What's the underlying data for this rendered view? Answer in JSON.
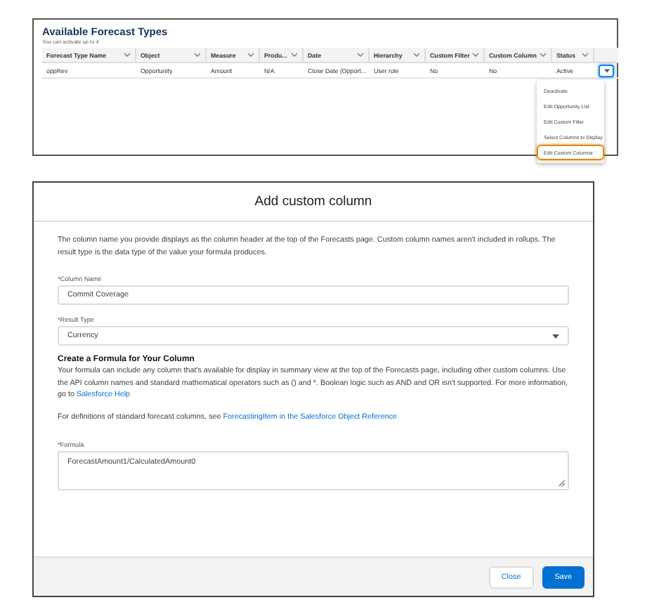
{
  "forecast_types": {
    "title": "Available Forecast Types",
    "subtitle": "You can activate up to 4",
    "columns": [
      {
        "label": "Forecast Type Name"
      },
      {
        "label": "Object"
      },
      {
        "label": "Measure"
      },
      {
        "label": "Produ..."
      },
      {
        "label": "Date"
      },
      {
        "label": "Hierarchy"
      },
      {
        "label": "Custom Filter"
      },
      {
        "label": "Custom Column"
      },
      {
        "label": "Status"
      }
    ],
    "rows": [
      {
        "cells": [
          "oppRev",
          "Opportunity",
          "Amount",
          "N/A",
          "Close Date (Opport...",
          "User role",
          "No",
          "No",
          "Active"
        ],
        "menu_open": true
      }
    ],
    "row_menu": [
      {
        "label": "Deactivate",
        "highlighted": false
      },
      {
        "label": "Edit Opportunity List",
        "highlighted": false
      },
      {
        "label": "Edit Custom Filter",
        "highlighted": false
      },
      {
        "label": "Select Columns to Display",
        "highlighted": false
      },
      {
        "label": "Edit Custom Columns",
        "highlighted": true
      }
    ]
  },
  "dialog": {
    "title": "Add custom column",
    "blocks": [
      {
        "kind": "paragraph",
        "text": "The column name you provide displays as the column header at the top of the Forecasts page. Custom column names aren't included in rollups. The result type is the data type of the value your formula produces."
      },
      {
        "kind": "input",
        "label": "Column Name",
        "required": true,
        "required_mark": "*",
        "value": "Commit Coverage"
      },
      {
        "kind": "select",
        "label": "Result Type",
        "required": true,
        "required_mark": "*",
        "value": "Currency"
      },
      {
        "kind": "heading",
        "text": "Create a Formula for Your Column"
      },
      {
        "kind": "paragraph",
        "text": "Your formula can include any column that's available for display in summary view at the top of the Forecasts page, including other custom columns. Use the API column names and standard mathematical operators such as () and *. Boolean logic such as AND and OR isn't supported. For more information, go to ",
        "link": "Salesforce Help"
      },
      {
        "kind": "paragraph",
        "text": "For definitions of standard forecast columns, see ",
        "link": "ForecastingItem in the Salesforce Object Reference"
      },
      {
        "kind": "textarea",
        "label": "Formula",
        "required": true,
        "required_mark": "*",
        "value": "ForecastAmount1/CalculatedAmount0"
      }
    ],
    "buttons": [
      {
        "label": "Close",
        "kind": "neutral"
      },
      {
        "label": "Save",
        "kind": "brand"
      }
    ]
  }
}
